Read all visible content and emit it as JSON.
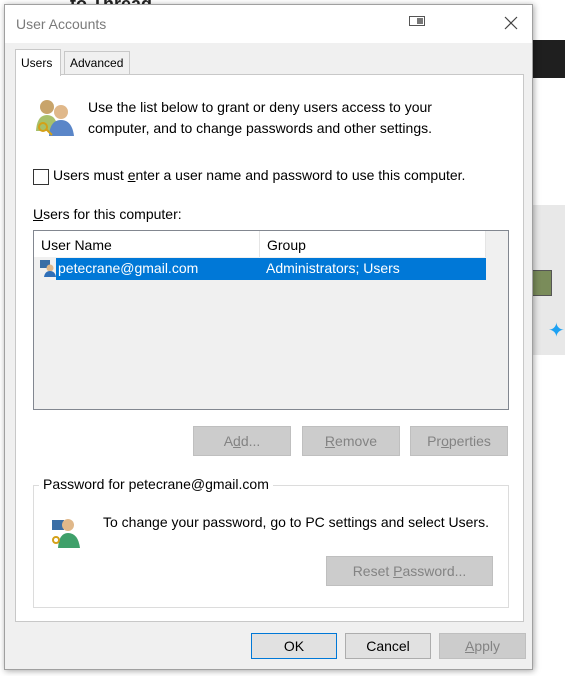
{
  "background": {
    "title_fragment": "to Thread"
  },
  "window": {
    "title": "User Accounts"
  },
  "tabs": [
    {
      "label": "Users",
      "active": true
    },
    {
      "label": "Advanced",
      "active": false
    }
  ],
  "intro_text": "Use the list below to grant or deny users access to your computer, and to change passwords and other settings.",
  "checkbox": {
    "label_pre": "Users must ",
    "label_accel": "e",
    "label_post": "nter a user name and password to use this computer.",
    "checked": false
  },
  "users_list": {
    "label_accel": "U",
    "label_rest": "sers for this computer:",
    "columns": [
      "User Name",
      "Group"
    ],
    "rows": [
      {
        "name": "petecrane@gmail.com",
        "group": "Administrators; Users",
        "selected": true
      }
    ]
  },
  "list_buttons": {
    "add": {
      "pre": "A",
      "accel": "d",
      "post": "d...",
      "disabled": true
    },
    "remove": {
      "pre": "",
      "accel": "R",
      "post": "emove",
      "disabled": true
    },
    "properties": {
      "pre": "Pr",
      "accel": "o",
      "post": "perties",
      "disabled": true
    }
  },
  "password_group": {
    "title": "Password for petecrane@gmail.com",
    "text": "To change your password, go to PC settings and select Users.",
    "reset_button": {
      "pre": "Reset ",
      "accel": "P",
      "post": "assword...",
      "disabled": true
    }
  },
  "footer_buttons": {
    "ok": "OK",
    "cancel": "Cancel",
    "apply": {
      "pre": "",
      "accel": "A",
      "post": "pply",
      "disabled": true
    }
  },
  "colors": {
    "selection": "#0078d7",
    "dialog_bg": "#f0f0f0",
    "disabled_text": "#838383"
  },
  "icons": [
    "restore-icon",
    "close-icon",
    "users-group-icon",
    "user-row-icon",
    "key-user-icon"
  ]
}
